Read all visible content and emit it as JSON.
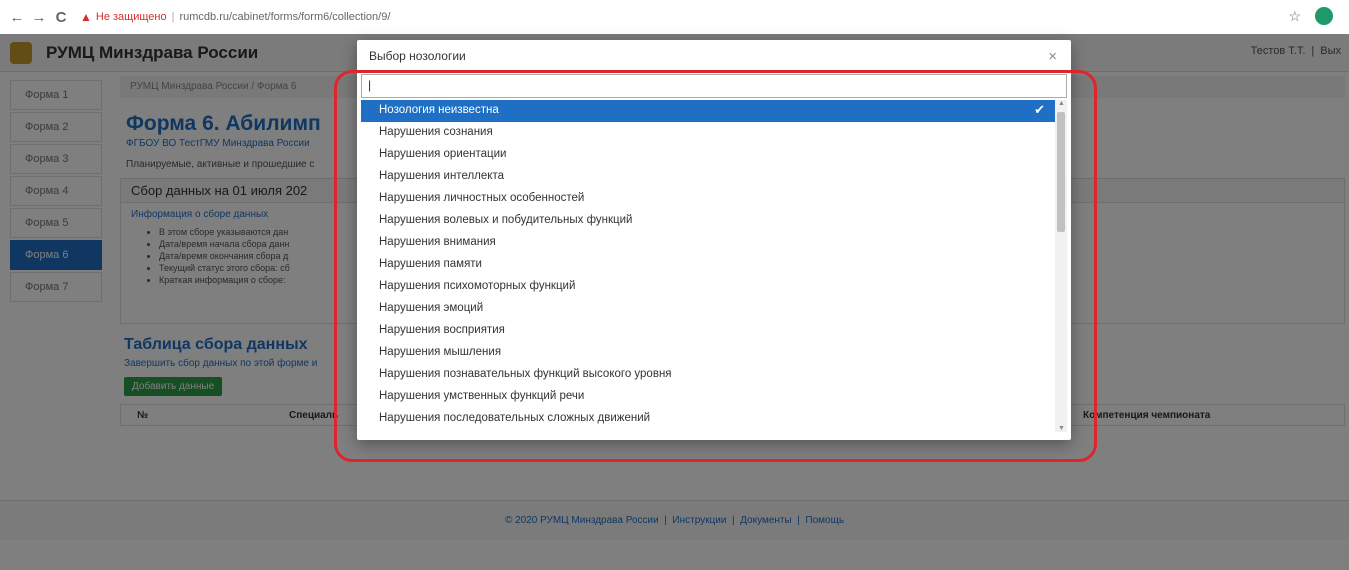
{
  "browser": {
    "back_icon": "←",
    "forward_icon": "→",
    "reload_icon": "C",
    "insecure_label": "Не защищено",
    "url": "rumcdb.ru/cabinet/forms/form6/collection/9/"
  },
  "navbar": {
    "brand": "РУМЦ Минздрава России",
    "user": "Тестов Т.Т.",
    "exit": "Вых"
  },
  "sidebar": {
    "items": [
      {
        "label": "Форма 1"
      },
      {
        "label": "Форма 2"
      },
      {
        "label": "Форма 3"
      },
      {
        "label": "Форма 4"
      },
      {
        "label": "Форма 5"
      },
      {
        "label": "Форма 6"
      },
      {
        "label": "Форма 7"
      }
    ],
    "active_index": 5
  },
  "content": {
    "breadcrumb": "РУМЦ Минздрава России / Форма 6",
    "title": "Форма 6. Абилимп",
    "org": "ФГБОУ ВО ТестГМУ Минздрава России",
    "desc": "Планируемые, активные и прошедшие с",
    "panel_title": "Сбор данных на 01 июля 202",
    "info_link": "Информация о сборе данных",
    "bullets": [
      "В этом сборе указываются дан",
      "Дата/время начала сбора данн",
      "Дата/время окончания сбора д",
      "Текущий статус этого сбора: сб",
      "Краткая информация о сборе:"
    ],
    "table_title": "Таблица сбора данных",
    "table_sub": "Завершить сбор данных по этой форме и",
    "add_button": "Добавить данные",
    "table_headers": [
      "№",
      "Специаль",
      "Компетенция чемпионата"
    ]
  },
  "footer": {
    "copyright": "© 2020 РУМЦ Минздрава России",
    "links": [
      "Инструкции",
      "Документы",
      "Помощь"
    ]
  },
  "modal": {
    "title": "Выбор нозологии",
    "close": "×",
    "search_value": "|",
    "selected_index": 0,
    "options": [
      "Нозология неизвестна",
      "Нарушения сознания",
      "Нарушения ориентации",
      "Нарушения интеллекта",
      "Нарушения личностных особенностей",
      "Нарушения волевых и побудительных функций",
      "Нарушения внимания",
      "Нарушения памяти",
      "Нарушения психомоторных функций",
      "Нарушения эмоций",
      "Нарушения восприятия",
      "Нарушения мышления",
      "Нарушения познавательных функций высокого уровня",
      "Нарушения умственных функций речи",
      "Нарушения последовательных сложных движений"
    ]
  }
}
